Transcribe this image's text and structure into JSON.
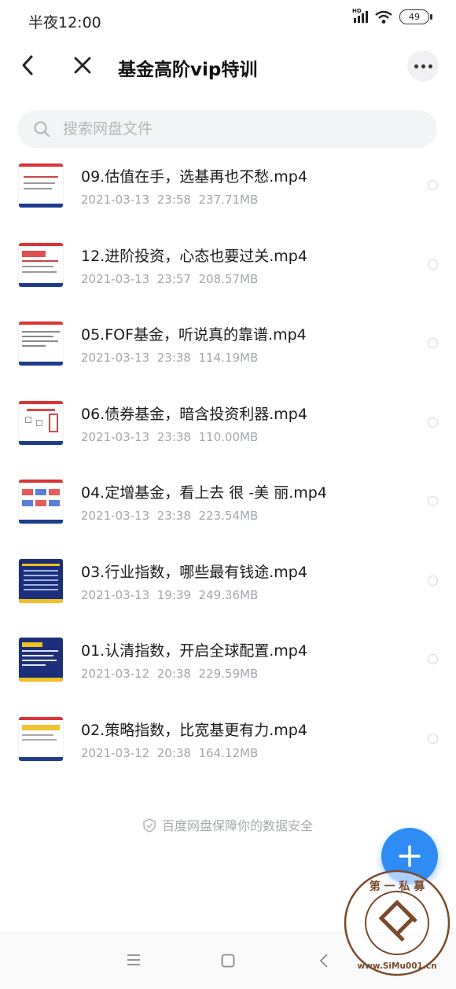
{
  "status_bar": {
    "time": "半夜12:00",
    "battery": "49",
    "network": "HD"
  },
  "header": {
    "title": "基金高阶vip特训"
  },
  "search": {
    "placeholder": "搜索网盘文件"
  },
  "files": [
    {
      "name": "09.估值在手，选基再也不愁.mp4",
      "date": "2021-03-13",
      "time": "23:58",
      "size": "237.71MB"
    },
    {
      "name": "12.进阶投资，心态也要过关.mp4",
      "date": "2021-03-13",
      "time": "23:57",
      "size": "208.57MB"
    },
    {
      "name": "05.FOF基金，听说真的靠谱.mp4",
      "date": "2021-03-13",
      "time": "23:38",
      "size": "114.19MB"
    },
    {
      "name": "06.债券基金，暗含投资利器.mp4",
      "date": "2021-03-13",
      "time": "23:38",
      "size": "110.00MB"
    },
    {
      "name": "04.定增基金，看上去 很 -美 丽.mp4",
      "date": "2021-03-13",
      "time": "23:38",
      "size": "223.54MB"
    },
    {
      "name": "03.行业指数，哪些最有钱途.mp4",
      "date": "2021-03-13",
      "time": "19:39",
      "size": "249.36MB"
    },
    {
      "name": "01.认清指数，开启全球配置.mp4",
      "date": "2021-03-12",
      "time": "20:38",
      "size": "229.59MB"
    },
    {
      "name": "02.策略指数，比宽基更有力.mp4",
      "date": "2021-03-12",
      "time": "20:38",
      "size": "164.12MB"
    }
  ],
  "footer": {
    "note": "百度网盘保障你的数据安全"
  },
  "watermark": {
    "top_text": "第 一 私 募",
    "bottom_text": "www.SiMu001.cn"
  },
  "colors": {
    "accent": "#2f8cf5",
    "meta_text": "#a3a6ab",
    "search_bg": "#f3f4f6"
  }
}
